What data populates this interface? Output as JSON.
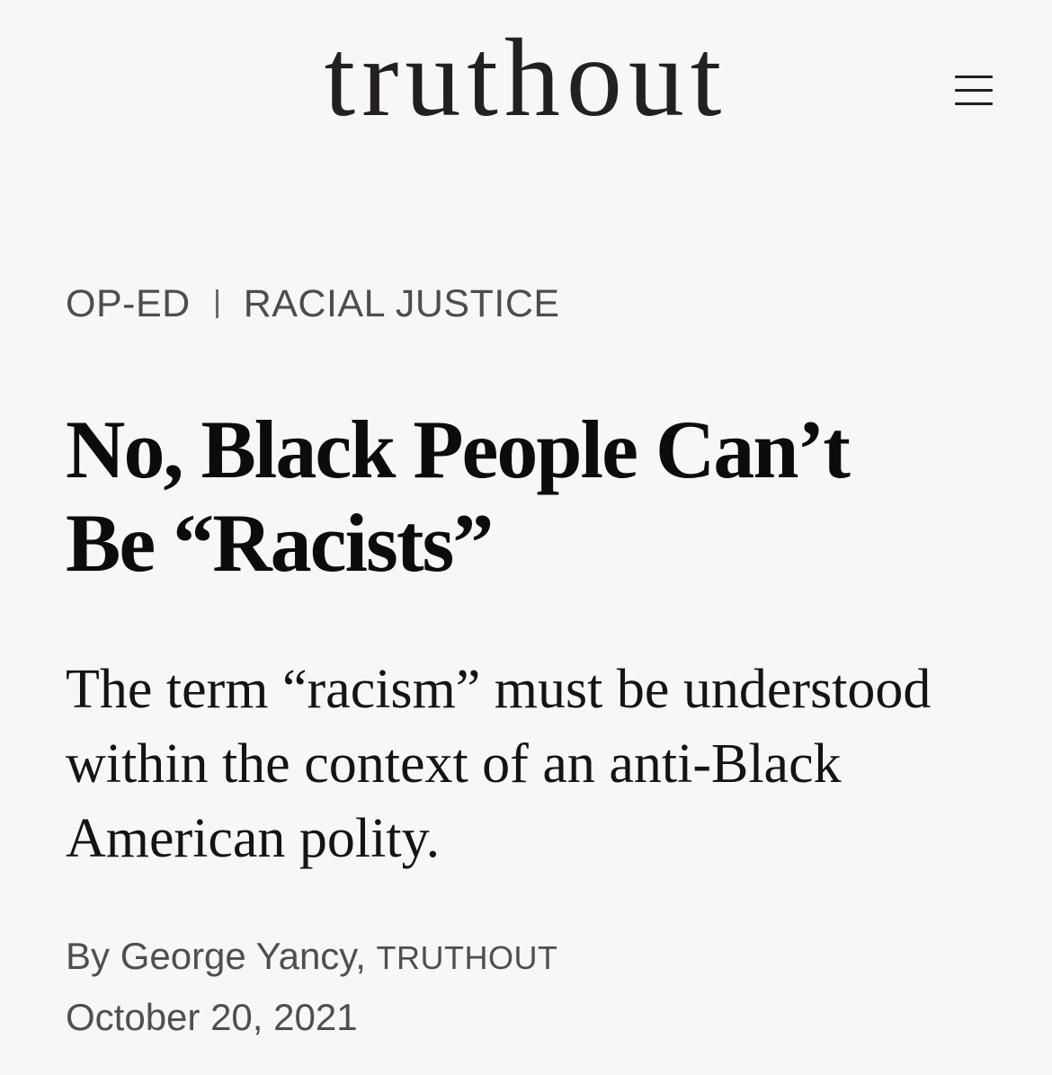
{
  "header": {
    "logo_text": "truthout",
    "menu_icon": "hamburger-menu-icon"
  },
  "categories": {
    "primary": "OP-ED",
    "secondary": "RACIAL JUSTICE"
  },
  "article": {
    "headline_line1": "No, Black People Can’t",
    "headline_line2": "Be “Racists”",
    "dek": "The term “racism” must be understood within the context of an anti-Black American polity.",
    "byline_prefix": "By ",
    "author": "George Yancy",
    "byline_separator": ", ",
    "publication": "TRUTHOUT",
    "date": "October 20, 2021"
  },
  "colors": {
    "background": "#f7f7f7",
    "logo": "#24201d",
    "headline": "#0c0c0c",
    "meta_text": "#4d4d4d"
  }
}
